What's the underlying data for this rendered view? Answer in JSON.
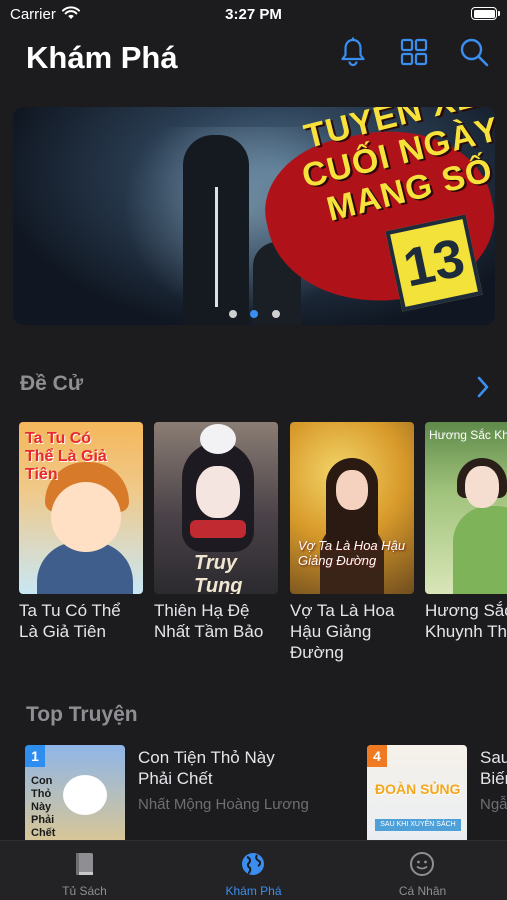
{
  "status_bar": {
    "carrier": "Carrier",
    "time": "3:27 PM"
  },
  "header": {
    "title": "Khám Phá"
  },
  "banner": {
    "cover_text": [
      "TUYẾN XE",
      "CUỐI NGÀY",
      "MANG SỐ"
    ],
    "cover_number": "13",
    "pager": {
      "count": 3,
      "active_index": 1
    }
  },
  "recommended": {
    "title": "Đề Cử",
    "books": [
      {
        "title": "Ta Tu Có Thể Là Giả Tiên",
        "cover_text": "Ta Tu Có Thể Là Giả Tiên"
      },
      {
        "title": "Thiên Hạ Đệ Nhất Tầm Bảo",
        "cover_text": "Truy Tung"
      },
      {
        "title": "Vợ Ta Là Hoa Hậu Giảng Đường",
        "cover_text": "Vợ Ta Là Hoa Hậu Giảng Đường"
      },
      {
        "title": "Hương Sắc Khuynh Thành",
        "cover_text": "Hương Sắc Khuynh Thành"
      }
    ]
  },
  "top": {
    "title": "Top Truyện",
    "items": [
      {
        "rank": "1",
        "title": "Con Tiện Thỏ Này Phải Chết",
        "author": "Nhất Mộng Hoàng Lương",
        "cover_text": "Con Thỏ Này Phải Chết"
      },
      {
        "rank": "4",
        "title": "Sau Khi Xuyên Sách Biến...",
        "author": "Ngẫu...",
        "cover_text": "ĐOÀN SỦNG",
        "cover_ribbon": "SAU KHI XUYÊN SÁCH"
      }
    ]
  },
  "tabs": [
    {
      "label": "Tủ Sách",
      "icon": "book-icon",
      "active": false
    },
    {
      "label": "Khám Phá",
      "icon": "globe-icon",
      "active": true
    },
    {
      "label": "Cá Nhân",
      "icon": "profile-icon",
      "active": false
    }
  ],
  "colors": {
    "accent": "#3a8ef0",
    "background": "#1c1c1e",
    "tabbar": "#232325"
  }
}
